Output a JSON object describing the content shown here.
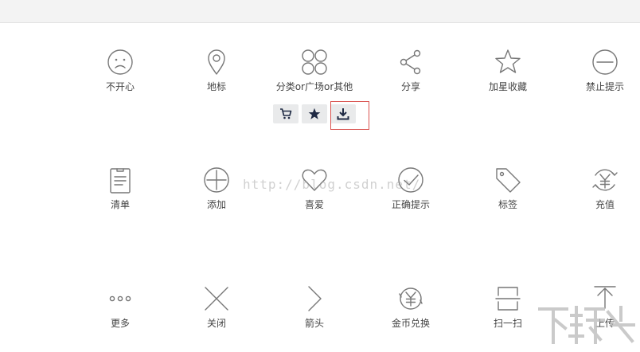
{
  "row1": [
    {
      "icon": "sad-face-icon",
      "label": "不开心"
    },
    {
      "icon": "map-pin-icon",
      "label": "地标"
    },
    {
      "icon": "four-circles-icon",
      "label": "分类or广场or其他"
    },
    {
      "icon": "share-icon",
      "label": "分享"
    },
    {
      "icon": "star-outline-icon",
      "label": "加星收藏"
    },
    {
      "icon": "forbidden-icon",
      "label": "禁止提示"
    }
  ],
  "row2": [
    {
      "icon": "clipboard-list-icon",
      "label": "清单"
    },
    {
      "icon": "plus-circle-icon",
      "label": "添加"
    },
    {
      "icon": "heart-icon",
      "label": "喜爱"
    },
    {
      "icon": "check-circle-icon",
      "label": "正确提示"
    },
    {
      "icon": "tag-icon",
      "label": "标签"
    },
    {
      "icon": "yuan-refresh-icon",
      "label": "充值"
    }
  ],
  "row3": [
    {
      "icon": "more-dots-icon",
      "label": "更多"
    },
    {
      "icon": "close-x-icon",
      "label": "关闭"
    },
    {
      "icon": "chevron-right-icon",
      "label": "箭头"
    },
    {
      "icon": "coin-exchange-icon",
      "label": "金币兑换"
    },
    {
      "icon": "scan-icon",
      "label": "扫一扫"
    },
    {
      "icon": "upload-icon",
      "label": "上传"
    }
  ],
  "toolbar": [
    {
      "icon": "cart-icon"
    },
    {
      "icon": "star-filled-icon"
    },
    {
      "icon": "download-icon"
    }
  ],
  "watermark": "http://blog.csdn.net/",
  "colors": {
    "icon_stroke": "#777777",
    "highlight": "#d9534f",
    "button_bg": "#e9eaeb",
    "dark_icon": "#1f2a44"
  }
}
